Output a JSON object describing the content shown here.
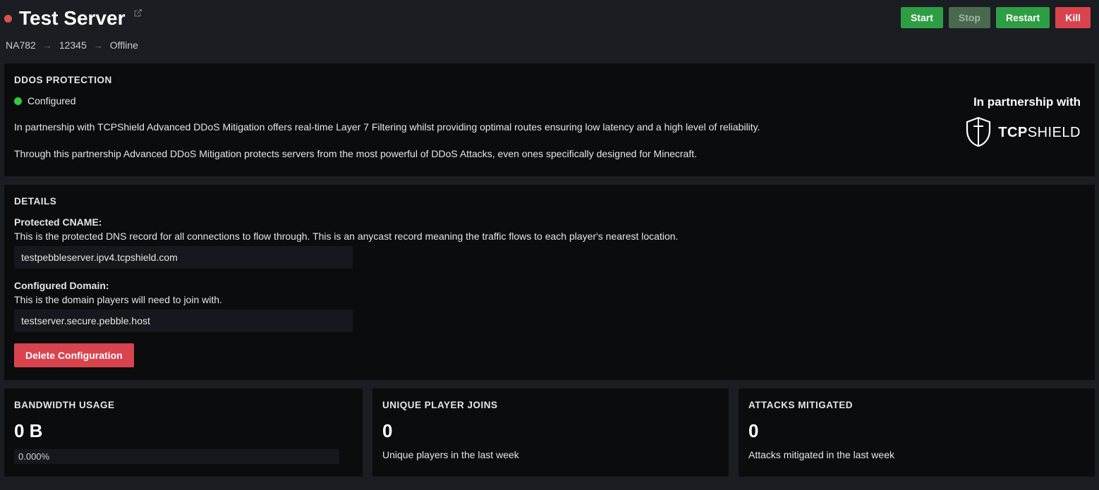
{
  "header": {
    "server_name": "Test Server",
    "status_color": "red",
    "edit_icon_name": "edit-icon",
    "buttons": {
      "start": "Start",
      "stop": "Stop",
      "restart": "Restart",
      "kill": "Kill"
    }
  },
  "breadcrumb": {
    "node": "NA782",
    "id": "12345",
    "status": "Offline"
  },
  "ddos": {
    "heading": "DDOS PROTECTION",
    "status_text": "Configured",
    "status_color": "green",
    "desc1": "In partnership with TCPShield Advanced DDoS Mitigation offers real-time Layer 7 Filtering whilst providing optimal routes ensuring low latency and a high level of reliability.",
    "desc2": "Through this partnership Advanced DDoS Mitigation protects servers from the most powerful of DDoS Attacks, even ones specifically designed for Minecraft.",
    "partner_label": "In partnership with",
    "partner_logo_text_a": "TCP",
    "partner_logo_text_b": "SHIELD"
  },
  "details": {
    "heading": "DETAILS",
    "cname_label": "Protected CNAME:",
    "cname_help": "This is the protected DNS record for all connections to flow through. This is an anycast record meaning the traffic flows to each player's nearest location.",
    "cname_value": "testpebbleserver.ipv4.tcpshield.com",
    "domain_label": "Configured Domain:",
    "domain_help": "This is the domain players will need to join with.",
    "domain_value": "testserver.secure.pebble.host",
    "delete_label": "Delete Configuration"
  },
  "stats": {
    "bandwidth": {
      "heading": "BANDWIDTH USAGE",
      "value": "0 B",
      "percent": "0.000%"
    },
    "players": {
      "heading": "UNIQUE PLAYER JOINS",
      "value": "0",
      "sub": "Unique players in the last week"
    },
    "attacks": {
      "heading": "ATTACKS MITIGATED",
      "value": "0",
      "sub": "Attacks mitigated in the last week"
    }
  }
}
